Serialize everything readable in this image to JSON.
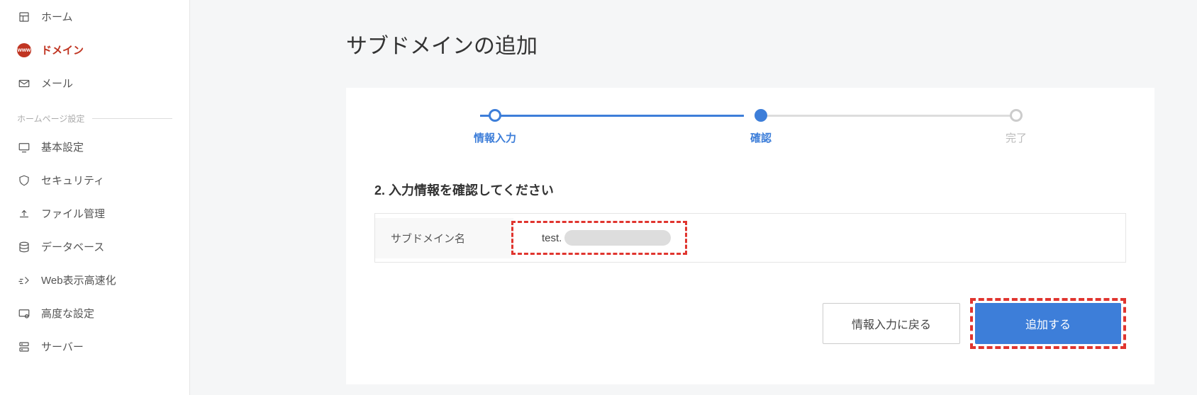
{
  "sidebar": {
    "items": [
      {
        "label": "ホーム",
        "icon": "home-icon"
      },
      {
        "label": "ドメイン",
        "icon": "www-icon",
        "active": true
      },
      {
        "label": "メール",
        "icon": "mail-icon"
      }
    ],
    "section_label": "ホームページ設定",
    "settings_items": [
      {
        "label": "基本設定",
        "icon": "monitor-icon"
      },
      {
        "label": "セキュリティ",
        "icon": "shield-icon"
      },
      {
        "label": "ファイル管理",
        "icon": "upload-icon"
      },
      {
        "label": "データベース",
        "icon": "database-icon"
      },
      {
        "label": "Web表示高速化",
        "icon": "speed-icon"
      },
      {
        "label": "高度な設定",
        "icon": "display-gear-icon"
      },
      {
        "label": "サーバー",
        "icon": "server-icon"
      }
    ]
  },
  "main": {
    "title": "サブドメインの追加",
    "steps": [
      {
        "label": "情報入力",
        "state": "done"
      },
      {
        "label": "確認",
        "state": "current"
      },
      {
        "label": "完了",
        "state": "future"
      }
    ],
    "instruction": "2. 入力情報を確認してください",
    "field_label": "サブドメイン名",
    "field_value_prefix": "test.",
    "back_label": "情報入力に戻る",
    "submit_label": "追加する"
  }
}
